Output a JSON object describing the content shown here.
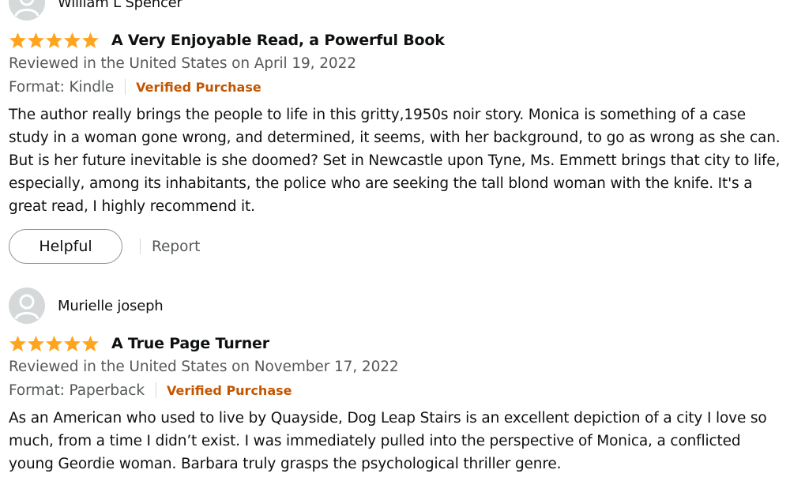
{
  "colors": {
    "star": "#ffa41c",
    "verified": "#c45500",
    "meta_text": "#565959",
    "body_text": "#0f1111",
    "avatar_bg": "#d5d9d9"
  },
  "reviews": [
    {
      "reviewer": "William L Spencer",
      "rating": 5,
      "title": "A Very Enjoyable Read, a Powerful Book",
      "date": "Reviewed in the United States on April 19, 2022",
      "format": "Format: Kindle",
      "verified": "Verified Purchase",
      "body_lines": [
        "The author really brings the people to life in this gritty,1950s noir story. Monica is something of a case",
        "study in a woman gone wrong, and determined, it seems, with her background, to go as wrong as she can.",
        "But is her future inevitable is she doomed? Set in Newcastle upon Tyne, Ms. Emmett brings that city to life,",
        "especially, among its inhabitants, the police who are seeking the tall blond woman with the knife. It's a",
        "great read, I highly recommend it."
      ],
      "helpful_label": "Helpful",
      "report_label": "Report"
    },
    {
      "reviewer": "Murielle joseph",
      "rating": 5,
      "title": "A True Page Turner",
      "date": "Reviewed in the United States on November 17, 2022",
      "format": "Format: Paperback",
      "verified": "Verified Purchase",
      "body_lines": [
        "As an American who used to live by Quayside, Dog Leap Stairs is an excellent depiction of a city I love so",
        "much, from a time I didn’t exist. I was immediately pulled into the perspective of Monica, a conflicted",
        "young Geordie woman. Barbara truly grasps the psychological thriller genre."
      ]
    }
  ]
}
